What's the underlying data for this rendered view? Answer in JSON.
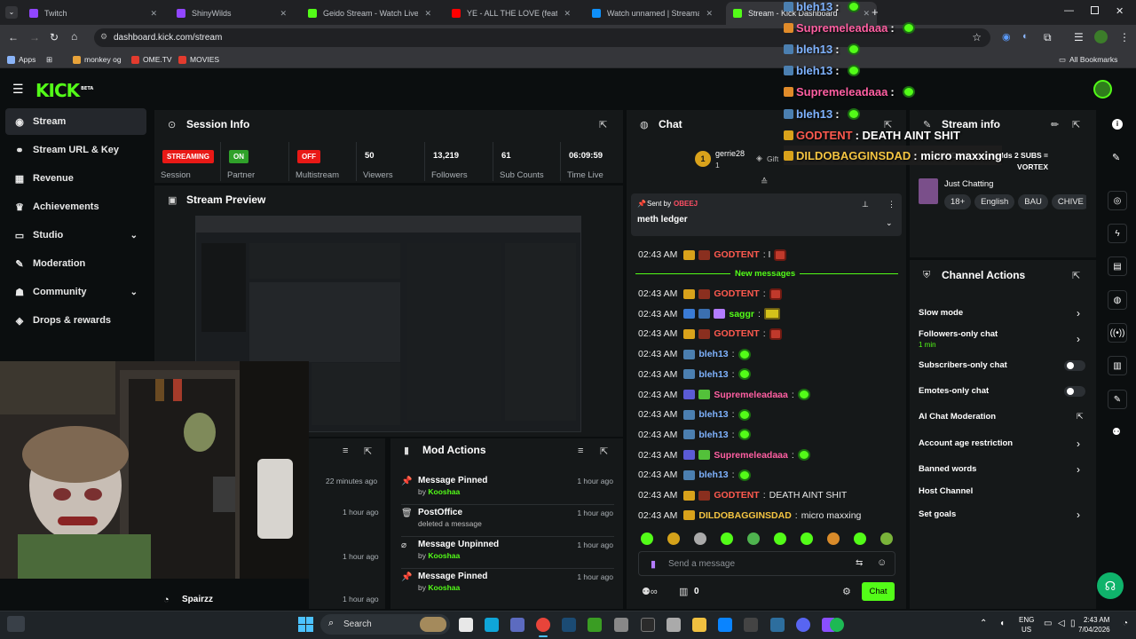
{
  "browser": {
    "tabs": [
      {
        "title": "Twitch",
        "color": "#9146ff"
      },
      {
        "title": "ShinyWilds",
        "color": "#9146ff"
      },
      {
        "title": "Geido Stream - Watch Live on K",
        "color": "#53fc18"
      },
      {
        "title": "YE - ALL THE LOVE (feat. ANDRE",
        "color": "#ff0000"
      },
      {
        "title": "Watch unnamed | Streamable",
        "color": "#0f90fa"
      },
      {
        "title": "Stream - Kick Dashboard",
        "color": "#53fc18"
      }
    ],
    "url": "dashboard.kick.com/stream",
    "bookmarks": [
      "Apps",
      "monkey og",
      "OME.TV",
      "MOVIES"
    ],
    "all_bookmarks": "All Bookmarks"
  },
  "header": {
    "logo": "KICK",
    "beta": "BETA"
  },
  "sidebar": {
    "items": [
      {
        "label": "Stream",
        "icon": "broadcast-icon",
        "glyph": "◉",
        "active": true
      },
      {
        "label": "Stream URL & Key",
        "icon": "link-icon",
        "glyph": "⚭"
      },
      {
        "label": "Revenue",
        "icon": "revenue-icon",
        "glyph": "▦"
      },
      {
        "label": "Achievements",
        "icon": "trophy-icon",
        "glyph": "♛"
      },
      {
        "label": "Studio",
        "icon": "studio-icon",
        "glyph": "▭",
        "expandable": true
      },
      {
        "label": "Moderation",
        "icon": "wrench-icon",
        "glyph": "✎"
      },
      {
        "label": "Community",
        "icon": "users-icon",
        "glyph": "☗",
        "expandable": true
      },
      {
        "label": "Drops & rewards",
        "icon": "gift-icon",
        "glyph": "◈"
      }
    ]
  },
  "session": {
    "title": "Session Info",
    "stats": [
      {
        "badge": "STREAMING",
        "badge_color": "#e91916",
        "label": "Session"
      },
      {
        "badge": "ON",
        "badge_color": "#2fa12a",
        "label": "Partner"
      },
      {
        "badge": "OFF",
        "badge_color": "#e91916",
        "label": "Multistream"
      },
      {
        "value": "50",
        "label": "Viewers"
      },
      {
        "value": "13,219",
        "label": "Followers"
      },
      {
        "value": "61",
        "label": "Sub Counts"
      },
      {
        "value": "06:09:59",
        "label": "Time Live"
      }
    ]
  },
  "preview": {
    "title": "Stream Preview"
  },
  "chat": {
    "title": "Chat",
    "top_gifter": {
      "rank": "1",
      "name": "gerrie28",
      "count": "1"
    },
    "gift_label": "Gift",
    "pinned": {
      "sent_by_label": "Sent by",
      "sender": "OBEEJ",
      "message": "meth ledger"
    },
    "partial_user": "GODTENT",
    "new_messages_label": "New messages",
    "messages": [
      {
        "time": "02:43 AM",
        "user": "GODTENT",
        "color": "#ff5a4f",
        "text": "",
        "emote": "red"
      },
      {
        "time": "02:43 AM",
        "user": "saggr",
        "color": "#53fc18",
        "text": "",
        "emote": "bang"
      },
      {
        "time": "02:43 AM",
        "user": "GODTENT",
        "color": "#ff5a4f",
        "text": "",
        "emote": "red"
      },
      {
        "time": "02:43 AM",
        "user": "bleh13",
        "color": "#7fb3ff",
        "text": "",
        "emote": "green"
      },
      {
        "time": "02:43 AM",
        "user": "bleh13",
        "color": "#7fb3ff",
        "text": "",
        "emote": "green"
      },
      {
        "time": "02:43 AM",
        "user": "Supremeleadaaa",
        "color": "#ff5fa2",
        "text": "",
        "emote": "green"
      },
      {
        "time": "02:43 AM",
        "user": "bleh13",
        "color": "#7fb3ff",
        "text": "",
        "emote": "green"
      },
      {
        "time": "02:43 AM",
        "user": "bleh13",
        "color": "#7fb3ff",
        "text": "",
        "emote": "green"
      },
      {
        "time": "02:43 AM",
        "user": "Supremeleadaaa",
        "color": "#ff5fa2",
        "text": "",
        "emote": "green"
      },
      {
        "time": "02:43 AM",
        "user": "bleh13",
        "color": "#7fb3ff",
        "text": "",
        "emote": "green"
      },
      {
        "time": "02:43 AM",
        "user": "GODTENT",
        "color": "#ff5a4f",
        "text": "DEATH AINT SHIT",
        "emote": ""
      },
      {
        "time": "02:43 AM",
        "user": "DILDOBAGGINSDAD",
        "color": "#f5c542",
        "text": "micro maxxing",
        "emote": ""
      }
    ],
    "input_placeholder": "Send a message",
    "points": "0",
    "send_label": "Chat"
  },
  "stream_info": {
    "title": "Stream info",
    "stream_title": "MONDAY| !shinywilds 2 SUBS = VORTEX",
    "category": "Just Chatting",
    "tags": [
      "18+",
      "English",
      "BAU",
      "CHIVE"
    ]
  },
  "channel_actions": {
    "title": "Channel Actions",
    "items": [
      {
        "label": "Slow mode",
        "control": "chevron"
      },
      {
        "label": "Followers-only chat",
        "sub": "1 min",
        "control": "chevron"
      },
      {
        "label": "Subscribers-only chat",
        "control": "toggle"
      },
      {
        "label": "Emotes-only chat",
        "control": "toggle"
      },
      {
        "label": "AI Chat Moderation",
        "control": "external"
      },
      {
        "label": "Account age restriction",
        "control": "chevron"
      },
      {
        "label": "Banned words",
        "control": "chevron"
      },
      {
        "label": "Host Channel",
        "control": "none"
      },
      {
        "label": "Set goals",
        "control": "chevron"
      }
    ]
  },
  "left_bottom": {
    "times": [
      "22 minutes ago",
      "1 hour ago",
      "1 hour ago",
      "1 hour ago"
    ],
    "user": "Spairzz"
  },
  "mod_actions": {
    "title": "Mod Actions",
    "items": [
      {
        "action": "Message Pinned",
        "by": "by",
        "user": "Kooshaa",
        "detail": "",
        "time": "1 hour ago",
        "glyph": "📌"
      },
      {
        "action": "PostOffice",
        "by": "",
        "user": "",
        "detail": "deleted a message",
        "time": "1 hour ago",
        "glyph": "🗑"
      },
      {
        "action": "Message Unpinned",
        "by": "by",
        "user": "Kooshaa",
        "detail": "",
        "time": "1 hour ago",
        "glyph": "⌀"
      },
      {
        "action": "Message Pinned",
        "by": "by",
        "user": "Kooshaa",
        "detail": "",
        "time": "1 hour ago",
        "glyph": "📌"
      }
    ]
  },
  "overlay": {
    "lines": [
      {
        "user": "bleh13",
        "color": "#7fb3ff",
        "text": ":",
        "emote": true
      },
      {
        "user": "Supremeleadaaa",
        "color": "#ff5fa2",
        "text": ":",
        "emote": true
      },
      {
        "user": "bleh13",
        "color": "#7fb3ff",
        "text": ":",
        "emote": true
      },
      {
        "user": "bleh13",
        "color": "#7fb3ff",
        "text": ":",
        "emote": true
      },
      {
        "user": "Supremeleadaaa",
        "color": "#ff5fa2",
        "text": ":",
        "emote": true
      },
      {
        "user": "bleh13",
        "color": "#7fb3ff",
        "text": ":",
        "emote": true
      },
      {
        "user": "GODTENT",
        "color": "#ff5a4f",
        "text": ": DEATH AINT SHIT",
        "emote": false
      },
      {
        "user": "DILDOBAGGINSDAD",
        "color": "#f5c542",
        "text": ": micro maxxing",
        "emote": false
      }
    ]
  },
  "taskbar": {
    "search": "Search",
    "lang": "ENG",
    "region": "US",
    "time": "2:43 AM",
    "date": "7/04/2026"
  },
  "colors": {
    "accent": "#53fc18",
    "panel": "#151819",
    "bg": "#0b0e0f"
  }
}
